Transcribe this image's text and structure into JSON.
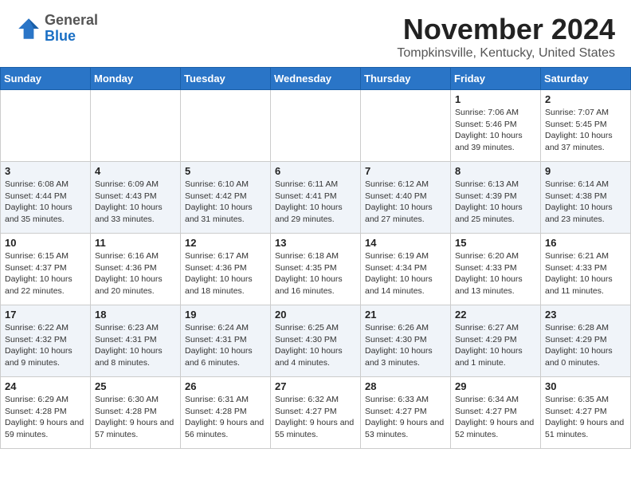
{
  "header": {
    "logo": {
      "general": "General",
      "blue": "Blue"
    },
    "title": "November 2024",
    "location": "Tompkinsville, Kentucky, United States"
  },
  "calendar": {
    "days_of_week": [
      "Sunday",
      "Monday",
      "Tuesday",
      "Wednesday",
      "Thursday",
      "Friday",
      "Saturday"
    ],
    "weeks": [
      {
        "cells": [
          {
            "day": "",
            "content": ""
          },
          {
            "day": "",
            "content": ""
          },
          {
            "day": "",
            "content": ""
          },
          {
            "day": "",
            "content": ""
          },
          {
            "day": "",
            "content": ""
          },
          {
            "day": "1",
            "content": "Sunrise: 7:06 AM\nSunset: 5:46 PM\nDaylight: 10 hours and 39 minutes."
          },
          {
            "day": "2",
            "content": "Sunrise: 7:07 AM\nSunset: 5:45 PM\nDaylight: 10 hours and 37 minutes."
          }
        ]
      },
      {
        "cells": [
          {
            "day": "3",
            "content": "Sunrise: 6:08 AM\nSunset: 4:44 PM\nDaylight: 10 hours and 35 minutes."
          },
          {
            "day": "4",
            "content": "Sunrise: 6:09 AM\nSunset: 4:43 PM\nDaylight: 10 hours and 33 minutes."
          },
          {
            "day": "5",
            "content": "Sunrise: 6:10 AM\nSunset: 4:42 PM\nDaylight: 10 hours and 31 minutes."
          },
          {
            "day": "6",
            "content": "Sunrise: 6:11 AM\nSunset: 4:41 PM\nDaylight: 10 hours and 29 minutes."
          },
          {
            "day": "7",
            "content": "Sunrise: 6:12 AM\nSunset: 4:40 PM\nDaylight: 10 hours and 27 minutes."
          },
          {
            "day": "8",
            "content": "Sunrise: 6:13 AM\nSunset: 4:39 PM\nDaylight: 10 hours and 25 minutes."
          },
          {
            "day": "9",
            "content": "Sunrise: 6:14 AM\nSunset: 4:38 PM\nDaylight: 10 hours and 23 minutes."
          }
        ]
      },
      {
        "cells": [
          {
            "day": "10",
            "content": "Sunrise: 6:15 AM\nSunset: 4:37 PM\nDaylight: 10 hours and 22 minutes."
          },
          {
            "day": "11",
            "content": "Sunrise: 6:16 AM\nSunset: 4:36 PM\nDaylight: 10 hours and 20 minutes."
          },
          {
            "day": "12",
            "content": "Sunrise: 6:17 AM\nSunset: 4:36 PM\nDaylight: 10 hours and 18 minutes."
          },
          {
            "day": "13",
            "content": "Sunrise: 6:18 AM\nSunset: 4:35 PM\nDaylight: 10 hours and 16 minutes."
          },
          {
            "day": "14",
            "content": "Sunrise: 6:19 AM\nSunset: 4:34 PM\nDaylight: 10 hours and 14 minutes."
          },
          {
            "day": "15",
            "content": "Sunrise: 6:20 AM\nSunset: 4:33 PM\nDaylight: 10 hours and 13 minutes."
          },
          {
            "day": "16",
            "content": "Sunrise: 6:21 AM\nSunset: 4:33 PM\nDaylight: 10 hours and 11 minutes."
          }
        ]
      },
      {
        "cells": [
          {
            "day": "17",
            "content": "Sunrise: 6:22 AM\nSunset: 4:32 PM\nDaylight: 10 hours and 9 minutes."
          },
          {
            "day": "18",
            "content": "Sunrise: 6:23 AM\nSunset: 4:31 PM\nDaylight: 10 hours and 8 minutes."
          },
          {
            "day": "19",
            "content": "Sunrise: 6:24 AM\nSunset: 4:31 PM\nDaylight: 10 hours and 6 minutes."
          },
          {
            "day": "20",
            "content": "Sunrise: 6:25 AM\nSunset: 4:30 PM\nDaylight: 10 hours and 4 minutes."
          },
          {
            "day": "21",
            "content": "Sunrise: 6:26 AM\nSunset: 4:30 PM\nDaylight: 10 hours and 3 minutes."
          },
          {
            "day": "22",
            "content": "Sunrise: 6:27 AM\nSunset: 4:29 PM\nDaylight: 10 hours and 1 minute."
          },
          {
            "day": "23",
            "content": "Sunrise: 6:28 AM\nSunset: 4:29 PM\nDaylight: 10 hours and 0 minutes."
          }
        ]
      },
      {
        "cells": [
          {
            "day": "24",
            "content": "Sunrise: 6:29 AM\nSunset: 4:28 PM\nDaylight: 9 hours and 59 minutes."
          },
          {
            "day": "25",
            "content": "Sunrise: 6:30 AM\nSunset: 4:28 PM\nDaylight: 9 hours and 57 minutes."
          },
          {
            "day": "26",
            "content": "Sunrise: 6:31 AM\nSunset: 4:28 PM\nDaylight: 9 hours and 56 minutes."
          },
          {
            "day": "27",
            "content": "Sunrise: 6:32 AM\nSunset: 4:27 PM\nDaylight: 9 hours and 55 minutes."
          },
          {
            "day": "28",
            "content": "Sunrise: 6:33 AM\nSunset: 4:27 PM\nDaylight: 9 hours and 53 minutes."
          },
          {
            "day": "29",
            "content": "Sunrise: 6:34 AM\nSunset: 4:27 PM\nDaylight: 9 hours and 52 minutes."
          },
          {
            "day": "30",
            "content": "Sunrise: 6:35 AM\nSunset: 4:27 PM\nDaylight: 9 hours and 51 minutes."
          }
        ]
      }
    ]
  }
}
